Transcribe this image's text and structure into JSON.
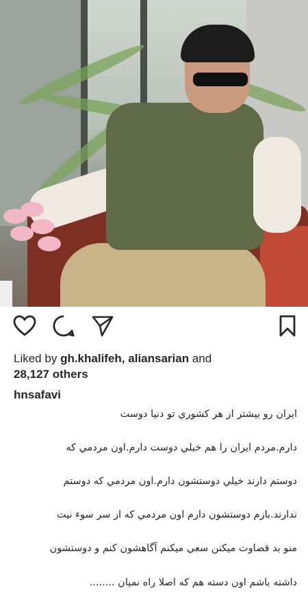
{
  "post": {
    "photo_alt": "Man in sunglasses and green vest seated on red sofa",
    "likes_prefix": "Liked by",
    "liker_1": "gh.khalifeh",
    "liker_sep": ",",
    "liker_2": "aliansarian",
    "likes_and": "and",
    "others_count": "28,127 others",
    "caption_username": "hnsafavi",
    "caption_lines": [
      "ایران رو بیشتر از هر کشوري تو دنیا دوست",
      "دارم.مردم ایران را هم خیلي دوست دارم.اون مردمي که",
      "دوستم دارند خیلي دوستشون دارم.اون مردمي که دوستم",
      "ندارند.بازم دوستشون دارم اون مردمي که از سر سوء نیت",
      "منو بد قضاوت میکنن سعي میکنم آگاهشون کنم و دوستشون",
      "داشته باشم اون دسته هم که اصلا راه نمیان ........"
    ]
  },
  "actions": {
    "like_icon": "heart-icon",
    "comment_icon": "comment-icon",
    "share_icon": "paper-plane-icon",
    "save_icon": "bookmark-icon"
  },
  "colors": {
    "text": "#262626",
    "background": "#ffffff"
  }
}
